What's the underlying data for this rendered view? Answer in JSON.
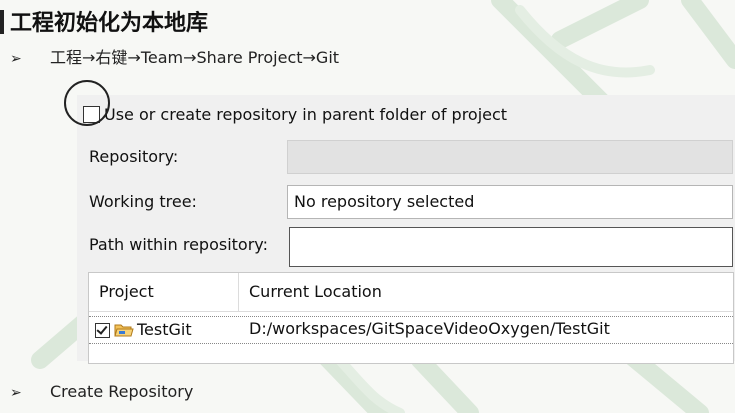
{
  "slide": {
    "title": "工程初始化为本地库",
    "step_bullet_marker": "➢",
    "step_text": "工程→右键→Team→Share Project→Git",
    "bottom_bullet_marker": "➢",
    "bottom_text": "Create Repository"
  },
  "dialog": {
    "checkbox_label": "Use or create repository in parent folder of project",
    "checkbox_checked": false,
    "repository_label": "Repository:",
    "repository_value": "",
    "working_tree_label": "Working tree:",
    "working_tree_value": "No repository selected",
    "path_label": "Path within repository:",
    "path_value": "",
    "table": {
      "columns": [
        "Project",
        "Current Location"
      ],
      "rows": [
        {
          "checked": true,
          "icon": "folder-icon",
          "project": "TestGit",
          "location": "D:/workspaces/GitSpaceVideoOxygen/TestGit"
        }
      ]
    }
  },
  "colors": {
    "background": "#f7f8f5",
    "dialog_background": "#f0f0f0",
    "disabled_field": "#e2e2e2",
    "leaf_green": "#cfe3cf",
    "folder": "#e8a93a"
  }
}
